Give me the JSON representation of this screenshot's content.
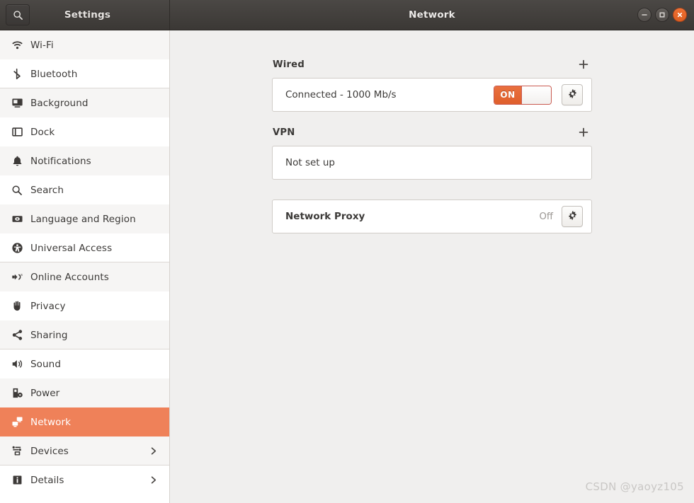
{
  "header": {
    "search_icon": "search-icon",
    "sidebar_title": "Settings",
    "page_title": "Network",
    "window_controls": {
      "minimize": "minimize-icon",
      "maximize": "maximize-icon",
      "close": "close-icon"
    }
  },
  "sidebar": {
    "items": [
      {
        "label": "Wi-Fi",
        "icon": "wifi-icon",
        "chevron": false,
        "selected": false,
        "separator_after": false
      },
      {
        "label": "Bluetooth",
        "icon": "bluetooth-icon",
        "chevron": false,
        "selected": false,
        "separator_after": true
      },
      {
        "label": "Background",
        "icon": "background-icon",
        "chevron": false,
        "selected": false,
        "separator_after": false
      },
      {
        "label": "Dock",
        "icon": "dock-icon",
        "chevron": false,
        "selected": false,
        "separator_after": false
      },
      {
        "label": "Notifications",
        "icon": "bell-icon",
        "chevron": false,
        "selected": false,
        "separator_after": false
      },
      {
        "label": "Search",
        "icon": "search-icon",
        "chevron": false,
        "selected": false,
        "separator_after": false
      },
      {
        "label": "Language and Region",
        "icon": "language-icon",
        "chevron": false,
        "selected": false,
        "separator_after": false
      },
      {
        "label": "Universal Access",
        "icon": "accessibility-icon",
        "chevron": false,
        "selected": false,
        "separator_after": true
      },
      {
        "label": "Online Accounts",
        "icon": "online-accounts-icon",
        "chevron": false,
        "selected": false,
        "separator_after": false
      },
      {
        "label": "Privacy",
        "icon": "hand-icon",
        "chevron": false,
        "selected": false,
        "separator_after": false
      },
      {
        "label": "Sharing",
        "icon": "share-icon",
        "chevron": false,
        "selected": false,
        "separator_after": true
      },
      {
        "label": "Sound",
        "icon": "speaker-icon",
        "chevron": false,
        "selected": false,
        "separator_after": false
      },
      {
        "label": "Power",
        "icon": "power-icon",
        "chevron": false,
        "selected": false,
        "separator_after": false
      },
      {
        "label": "Network",
        "icon": "network-icon",
        "chevron": false,
        "selected": true,
        "separator_after": false
      },
      {
        "label": "Devices",
        "icon": "devices-icon",
        "chevron": true,
        "selected": false,
        "separator_after": true
      },
      {
        "label": "Details",
        "icon": "info-icon",
        "chevron": true,
        "selected": false,
        "separator_after": false
      }
    ]
  },
  "main": {
    "wired": {
      "title": "Wired",
      "add_label": "+",
      "status": "Connected - 1000 Mb/s",
      "toggle_state": "ON",
      "settings_icon": "gear-icon"
    },
    "vpn": {
      "title": "VPN",
      "add_label": "+",
      "status": "Not set up"
    },
    "proxy": {
      "title": "Network Proxy",
      "state": "Off",
      "settings_icon": "gear-icon"
    }
  },
  "watermark": "CSDN @yaoyz105",
  "colors": {
    "accent": "#ef8159",
    "toggle_on": "#e3652f",
    "headerbar": "#413e3b",
    "content_bg": "#f0efee",
    "panel_bg": "#ffffff",
    "close_button": "#ef6f31"
  }
}
